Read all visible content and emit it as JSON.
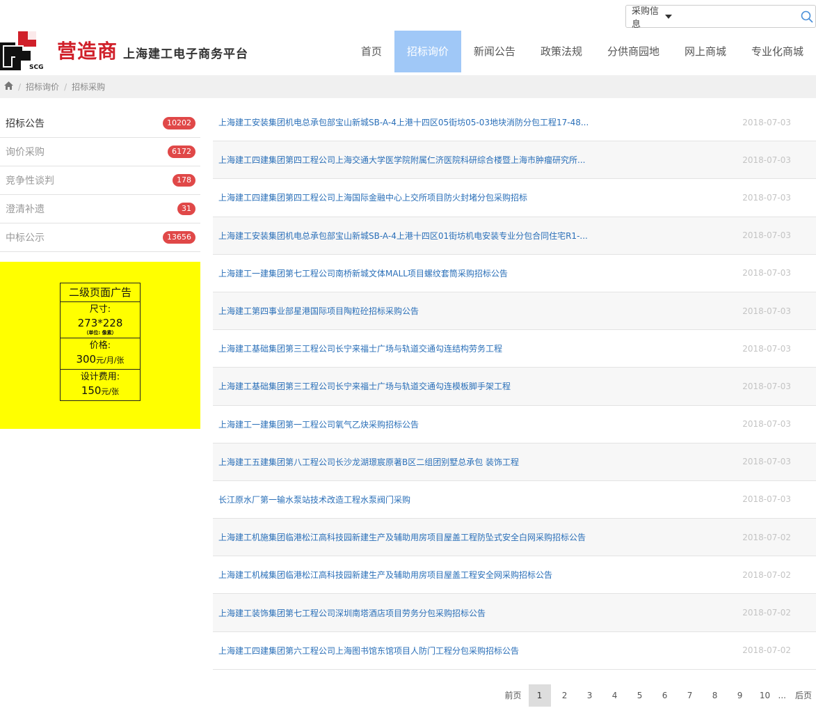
{
  "search": {
    "category": "采购信息",
    "placeholder": ""
  },
  "logo": {
    "mark_text": "SCG",
    "brand": "营造商",
    "subtitle": "上海建工电子商务平台"
  },
  "nav": [
    {
      "label": "首页",
      "active": false
    },
    {
      "label": "招标询价",
      "active": true
    },
    {
      "label": "新闻公告",
      "active": false
    },
    {
      "label": "政策法规",
      "active": false
    },
    {
      "label": "分供商园地",
      "active": false
    },
    {
      "label": "网上商城",
      "active": false
    },
    {
      "label": "专业化商城",
      "active": false
    }
  ],
  "breadcrumb": [
    "招标询价",
    "招标采购"
  ],
  "sidebar": [
    {
      "label": "招标公告",
      "count": "10202",
      "active": true
    },
    {
      "label": "询价采购",
      "count": "6172",
      "active": false
    },
    {
      "label": "竞争性谈判",
      "count": "178",
      "active": false
    },
    {
      "label": "澄清补遗",
      "count": "31",
      "active": false
    },
    {
      "label": "中标公示",
      "count": "13656",
      "active": false
    }
  ],
  "ad": {
    "title": "二级页面广告",
    "size_label": "尺寸:",
    "size_value": "273*228",
    "size_unit": "（单位: 像素）",
    "price_label": "价格:",
    "price_value": "300",
    "price_unit": "元/月/张",
    "design_label": "设计费用:",
    "design_value": "150",
    "design_unit": "元/张"
  },
  "notices": [
    {
      "title": "上海建工安装集团机电总承包部宝山新城SB-A-4上港十四区05街坊05-03地块消防分包工程17-48...",
      "date": "2018-07-03"
    },
    {
      "title": "上海建工四建集团第四工程公司上海交通大学医学院附属仁济医院科研综合楼暨上海市肿瘤研究所...",
      "date": "2018-07-03"
    },
    {
      "title": "上海建工四建集团第四工程公司上海国际金融中心上交所项目防火封堵分包采购招标",
      "date": "2018-07-03"
    },
    {
      "title": "上海建工安装集团机电总承包部宝山新城SB-A-4上港十四区01街坊机电安装专业分包合同住宅R1-...",
      "date": "2018-07-03"
    },
    {
      "title": "上海建工一建集团第七工程公司南桥新城文体MALL项目螺纹套筒采购招标公告",
      "date": "2018-07-03"
    },
    {
      "title": "上海建工第四事业部星港国际项目陶粒砼招标采购公告",
      "date": "2018-07-03"
    },
    {
      "title": "上海建工基础集团第三工程公司长宁来福士广场与轨道交通勾连结构劳务工程",
      "date": "2018-07-03"
    },
    {
      "title": "上海建工基础集团第三工程公司长宁来福士广场与轨道交通勾连模板脚手架工程",
      "date": "2018-07-03"
    },
    {
      "title": "上海建工一建集团第一工程公司氧气乙炔采购招标公告",
      "date": "2018-07-03"
    },
    {
      "title": "上海建工五建集团第八工程公司长沙龙湖璟宸原著B区二组团别墅总承包 装饰工程",
      "date": "2018-07-03"
    },
    {
      "title": "长江原水厂第一输水泵站技术改造工程水泵阀门采购",
      "date": "2018-07-03"
    },
    {
      "title": "上海建工机施集团临港松江高科技园新建生产及辅助用房项目屋盖工程防坠式安全白网采购招标公告",
      "date": "2018-07-02"
    },
    {
      "title": "上海建工机械集团临港松江高科技园新建生产及辅助用房项目屋盖工程安全网采购招标公告",
      "date": "2018-07-02"
    },
    {
      "title": "上海建工装饰集团第七工程公司深圳南塔酒店项目劳务分包采购招标公告",
      "date": "2018-07-02"
    },
    {
      "title": "上海建工四建集团第六工程公司上海图书馆东馆项目人防门工程分包采购招标公告",
      "date": "2018-07-02"
    }
  ],
  "pagination": {
    "first": "前页",
    "pages": [
      "1",
      "2",
      "3",
      "4",
      "5",
      "6",
      "7",
      "8",
      "9",
      "10"
    ],
    "current": "1",
    "ellipsis": "...",
    "last": "后页"
  },
  "colors": {
    "accent": "#a0c8f7",
    "link": "#2a6fb8",
    "badge": "#e04848",
    "brand_red": "#d0202a",
    "ad_bg": "#ffff00"
  },
  "icons": {
    "search": "search-icon",
    "home": "home-icon",
    "caret": "caret-down-icon"
  }
}
